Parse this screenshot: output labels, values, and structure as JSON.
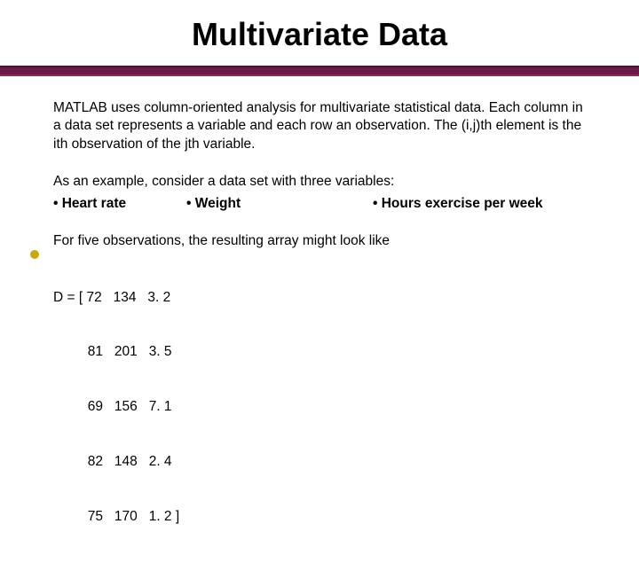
{
  "title": "Multivariate Data",
  "para1": "MATLAB uses column-oriented analysis for multivariate statistical data. Each column in a data set represents a variable and each row an observation.   The (i,j)th element is the ith observation of the jth variable.",
  "example_intro": "As an example, consider a data set with three variables:",
  "bullets": {
    "b1": "• Heart rate",
    "b2": "• Weight",
    "b3": "• Hours exercise per week"
  },
  "para3_intro": "For five observations, the resulting array might look like",
  "matrix": {
    "l1": "D = [ 72   134   3. 2",
    "l2": "         81   201   3. 5",
    "l3": "         69   156   7. 1",
    "l4": "         82   148   2. 4",
    "l5": "         75   170   1. 2 ]"
  }
}
